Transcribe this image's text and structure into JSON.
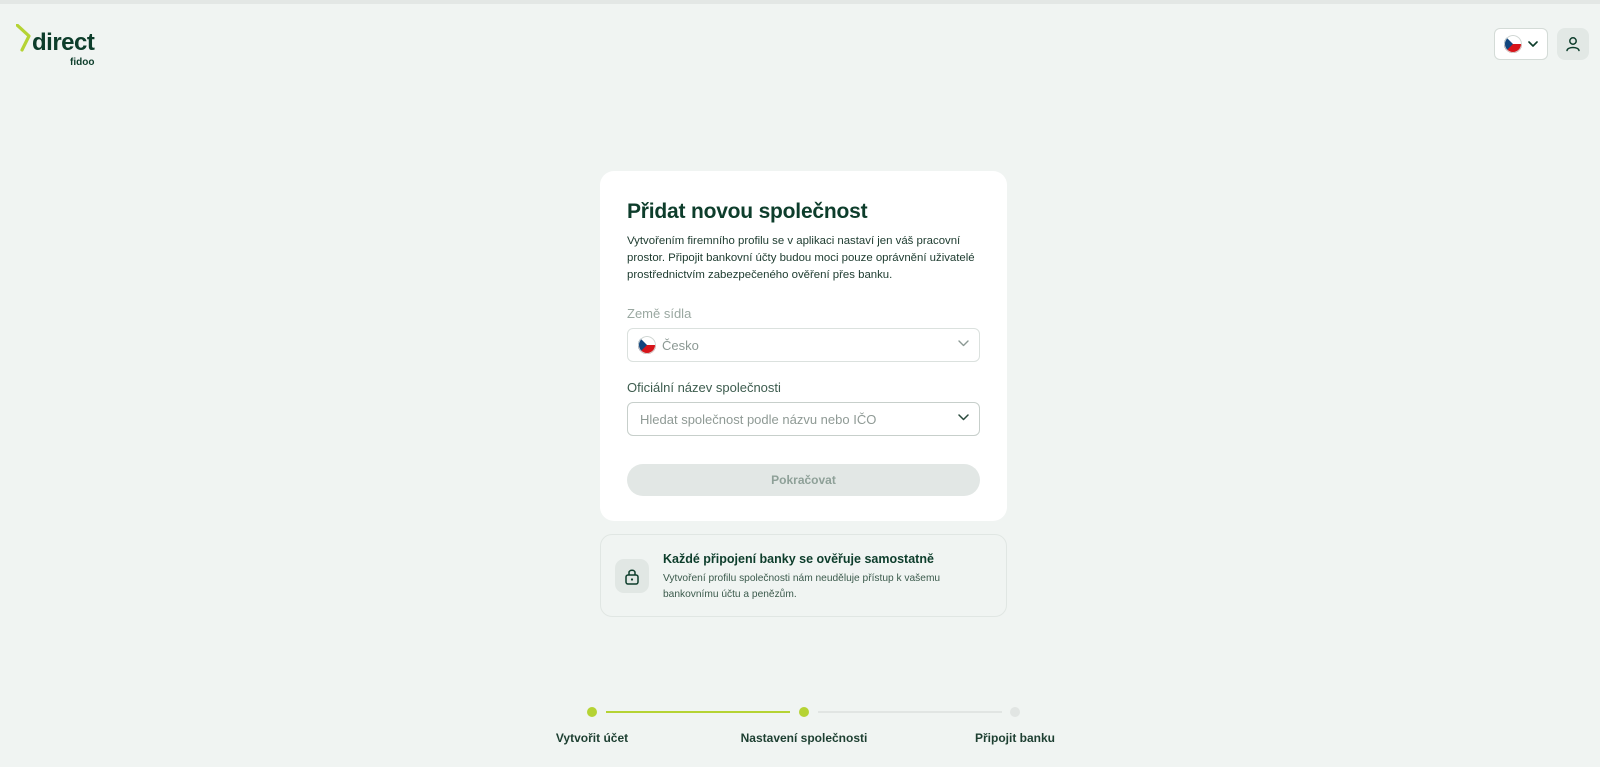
{
  "brand": {
    "logo_word": "direct",
    "logo_sub": "fidoo",
    "accent": "#b5d334",
    "primary": "#0d3d2b"
  },
  "header": {
    "language_icon": "czech-flag-icon",
    "user_icon": "user-icon"
  },
  "card": {
    "title": "Přidat novou společnost",
    "description": "Vytvořením firemního profilu se v aplikaci nastaví jen váš pracovní prostor. Připojit bankovní účty budou moci pouze oprávnění uživatelé prostřednictvím zabezpečeného ověření přes banku.",
    "country_label": "Země sídla",
    "country_value": "Česko",
    "company_label": "Oficiální název společnosti",
    "company_placeholder": "Hledat společnost podle názvu nebo IČO",
    "continue_label": "Pokračovat"
  },
  "info": {
    "icon": "lock-icon",
    "title": "Každé připojení banky se ověřuje samostatně",
    "text": "Vytvoření profilu společnosti nám neuděluje přístup k vašemu bankovnímu účtu a penězům."
  },
  "steps": [
    {
      "label": "Vytvořit účet",
      "state": "done"
    },
    {
      "label": "Nastavení společnosti",
      "state": "current"
    },
    {
      "label": "Připojit banku",
      "state": "todo"
    }
  ]
}
